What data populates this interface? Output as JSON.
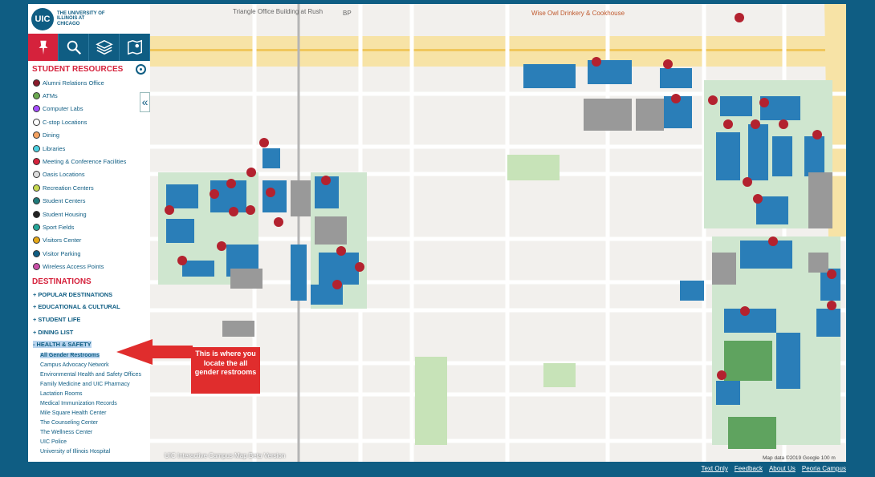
{
  "logo": {
    "initials": "UIC",
    "name": "THE UNIVERSITY OF ILLINOIS AT CHICAGO"
  },
  "toolbar": {
    "tools": [
      "pin-icon",
      "search-icon",
      "layers-icon",
      "map-icon"
    ]
  },
  "student_resources": {
    "title": "STUDENT RESOURCES",
    "items": [
      {
        "label": "Alumni Relations Office",
        "color": "#8b1a2b"
      },
      {
        "label": "ATMs",
        "color": "#6aa84f"
      },
      {
        "label": "Computer Labs",
        "color": "#a64dff"
      },
      {
        "label": "C-stop Locations",
        "color": "#ffffff"
      },
      {
        "label": "Dining",
        "color": "#f4a261"
      },
      {
        "label": "Libraries",
        "color": "#4dd0e1"
      },
      {
        "label": "Meeting & Conference Facilities",
        "color": "#d5223c"
      },
      {
        "label": "Oasis Locations",
        "color": "#dddddd"
      },
      {
        "label": "Recreation Centers",
        "color": "#c6d84f"
      },
      {
        "label": "Student Centers",
        "color": "#1f7a7a"
      },
      {
        "label": "Student Housing",
        "color": "#222222"
      },
      {
        "label": "Sport Fields",
        "color": "#26a69a"
      },
      {
        "label": "Visitors Center",
        "color": "#e6a817"
      },
      {
        "label": "Visitor Parking",
        "color": "#0f5d83"
      },
      {
        "label": "Wireless Access Points",
        "color": "#c94fa8"
      }
    ]
  },
  "destinations": {
    "title": "DESTINATIONS",
    "categories": [
      "+ POPULAR DESTINATIONS",
      "+ EDUCATIONAL & CULTURAL",
      "+ STUDENT LIFE",
      "+ DINING LIST",
      "- HEALTH & SAFETY"
    ],
    "health_safety_items": [
      "All Gender Restrooms",
      "Campus Advocacy Network",
      "Environmental Health and Safety Offices",
      "Family Medicine and UIC Pharmacy",
      "Lactation Rooms",
      "Medical Immunization Records",
      "Mile Square Health Center",
      "The Counseling Center",
      "The Wellness Center",
      "UIC Police",
      "University of Illinois Hospital"
    ]
  },
  "collapse_glyph": "«",
  "callout": {
    "text": "This is where you locate the all gender restrooms"
  },
  "map": {
    "labels": {
      "triangle": "Triangle Office Building at Rush",
      "bp": "BP",
      "wise_owl": "Wise Owl Drinkery & Cookhouse"
    },
    "credit": "Map data ©2019 Google   100 m",
    "beta": "UIC Interactive Campus Map Beta Version"
  },
  "footer": {
    "links": [
      "Text Only",
      "Feedback",
      "About Us",
      "Peoria Campus"
    ]
  }
}
